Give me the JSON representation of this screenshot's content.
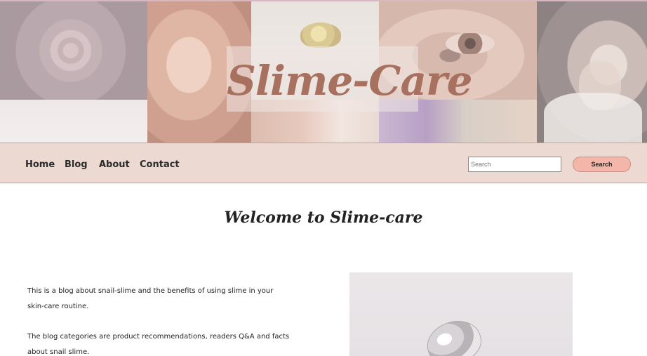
{
  "header": {
    "logo_text": "Slime-Care"
  },
  "nav": {
    "items": [
      {
        "label": "Home"
      },
      {
        "label": "Blog"
      },
      {
        "label": "About"
      },
      {
        "label": "Contact"
      }
    ],
    "search_placeholder": "Search",
    "search_button": "Search"
  },
  "main": {
    "welcome_title": "Welcome to Slime-care",
    "paragraph_1": "This is a blog about snail-slime and the benefits of using slime in your skin-care routine.",
    "paragraph_2": "The blog categories are product recommendations, readers Q&A and facts about snail slime."
  },
  "colors": {
    "logo": "#a8705f",
    "navbar_bg": "#ecd9d2",
    "search_button_bg": "#f4b6a8"
  }
}
